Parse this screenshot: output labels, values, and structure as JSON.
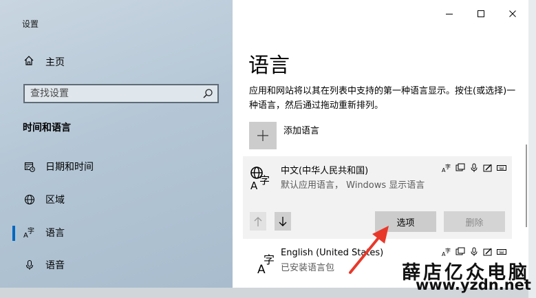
{
  "window": {
    "title": "设置"
  },
  "sidebar": {
    "home_label": "主页",
    "search_placeholder": "查找设置",
    "section_title": "时间和语言",
    "items": [
      {
        "label": "日期和时间",
        "icon": "calendar-clock-icon",
        "selected": false
      },
      {
        "label": "区域",
        "icon": "globe-icon",
        "selected": false
      },
      {
        "label": "语言",
        "icon": "language-icon",
        "selected": true
      },
      {
        "label": "语音",
        "icon": "microphone-icon",
        "selected": false
      }
    ]
  },
  "main": {
    "title": "语言",
    "description": "应用和网站将以其在列表中支持的第一种语言显示。按住(或选择)一种语言，然后通过拖动重新排列。",
    "add_language_label": "添加语言",
    "languages": [
      {
        "name": "中文(中华人民共和国)",
        "subtitle": "默认应用语言， Windows 显示语言"
      },
      {
        "name": "English (United States)",
        "subtitle": "已安装语言包"
      }
    ],
    "buttons": {
      "options": "选项",
      "remove": "删除"
    }
  },
  "watermark": {
    "line1": "薛店亿众电脑",
    "line2": "www.yzdn.net"
  },
  "colors": {
    "accent": "#0067c0",
    "callout": "#e8382a"
  }
}
